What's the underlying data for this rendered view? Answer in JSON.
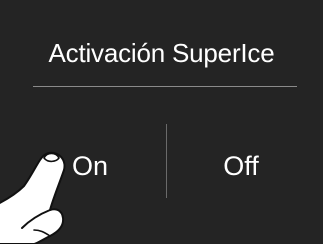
{
  "panel": {
    "title": "Activación SuperIce",
    "background": "#242424"
  },
  "options": {
    "on_label": "On",
    "off_label": "Off"
  },
  "pointer": {
    "icon": "hand-pointer-icon"
  }
}
